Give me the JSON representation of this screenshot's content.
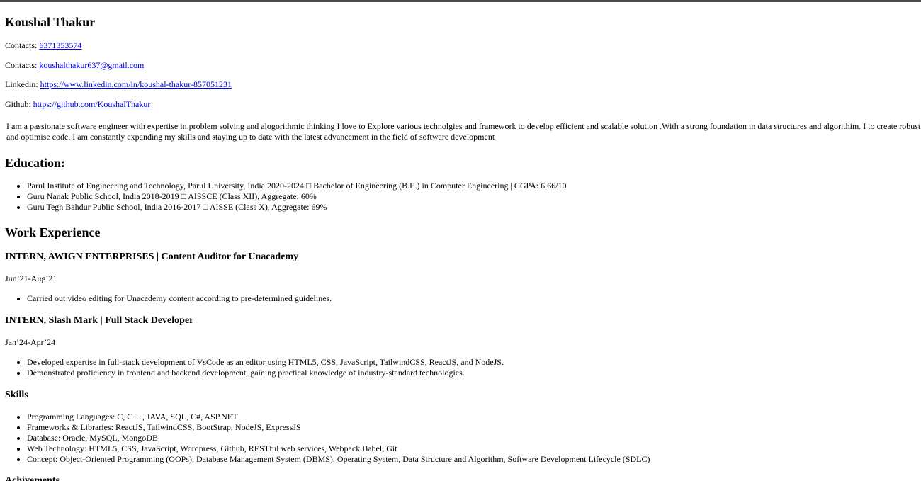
{
  "name": "Koushal Thakur",
  "contacts": [
    {
      "label": "Contacts:",
      "value": "6371353574"
    },
    {
      "label": "Contacts:",
      "value": "koushalthakur637@gmail.com"
    },
    {
      "label": "Linkedin:",
      "value": "https://www.linkedin.com/in/koushal-thakur-857051231"
    },
    {
      "label": "Github:",
      "value": "https://github.com/KoushalThakur"
    }
  ],
  "about": "I am a passionate software engineer with expertise in problem solving and alogorithmic thinking I love to Explore various technolgies and framework to develop efficient and scalable solution .With a strong foundation in data structures and algorithim. I to create robust and optimise code. I am constantly expanding my skills and staying up to date with the latest advancement in the field of software development",
  "education": {
    "title": "Education:",
    "items": [
      "Parul Institute of Engineering and Technology, Parul University, India 2020-2024 □ Bachelor of Engineering (B.E.) in Computer Engineering | CGPA: 6.66/10",
      "Guru Nanak Public School, India 2018-2019 □ AISSCE (Class XII), Aggregate: 60%",
      "Guru Tegh Bahdur Public School, India 2016-2017 □ AISSE (Class X), Aggregate: 69%"
    ]
  },
  "work": {
    "title": "Work Experience",
    "jobs": [
      {
        "heading": "INTERN, AWIGN ENTERPRISES | Content Auditor for Unacademy",
        "date": "Jun’21-Aug’21",
        "points": [
          "Carried out video editing for Unacademy content according to pre-determined guidelines."
        ]
      },
      {
        "heading": "INTERN, Slash Mark | Full Stack Developer",
        "date": "Jan’24-Apr’24",
        "points": [
          "Developed expertise in full-stack development of VsCode as an editor using HTML5, CSS, JavaScript, TailwindCSS, ReactJS, and NodeJS.",
          "Demonstrated proficiency in frontend and backend development, gaining practical knowledge of industry-standard technologies."
        ]
      }
    ]
  },
  "skills": {
    "title": "Skills",
    "items": [
      "Programming Languages: C, C++, JAVA, SQL, C#, ASP.NET",
      "Frameworks & Libraries: ReactJS, TailwindCSS, BootStrap, NodeJS, ExpressJS",
      "Database: Oracle, MySQL, MongoDB",
      "Web Technology: HTML5, CSS, JavaScript, Wordpress, Github, RESTful web services, Webpack Babel, Git",
      "Concept: Object-Oriented Programming (OOPs), Database Management System (DBMS), Operating System, Data Structure and Algorithm, Software Development Lifecycle (SDLC)"
    ]
  },
  "achievements": {
    "title": "Achivements"
  }
}
